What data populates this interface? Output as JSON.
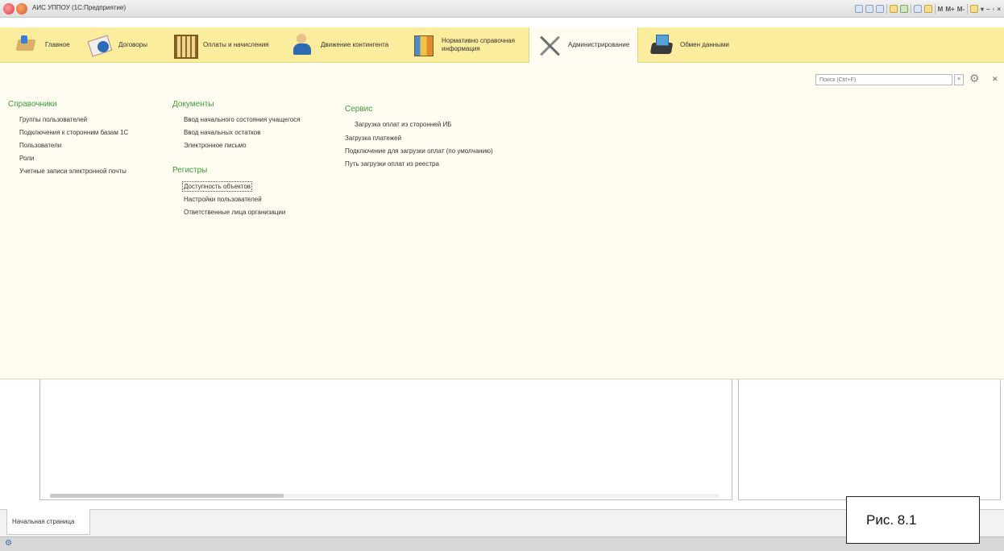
{
  "window": {
    "title": "АИС УППОУ  (1С:Предприятие)"
  },
  "toolbar": {
    "m_labels": [
      "M",
      "M+",
      "M-"
    ]
  },
  "sections": [
    {
      "label": "Главное",
      "icon": "home-icon"
    },
    {
      "label": "Договоры",
      "icon": "contract-icon"
    },
    {
      "label": "Оплаты и начисления",
      "icon": "payments-icon"
    },
    {
      "label": "Движение контингента",
      "icon": "contingent-icon"
    },
    {
      "label": "Нормативно справочная\nинформация",
      "icon": "reference-info-icon"
    },
    {
      "label": "Администрирование",
      "icon": "tools-icon",
      "active": true
    },
    {
      "label": "Обмен данными",
      "icon": "data-exchange-icon"
    }
  ],
  "search": {
    "placeholder": "Поиск (Ctrl+F)"
  },
  "groups": {
    "directories": {
      "title": "Справочники",
      "items": [
        "Группы пользователей",
        "Подключения к сторонним базам 1С",
        "Пользователи",
        "Роли",
        "Учетные записи электронной почты"
      ]
    },
    "documents": {
      "title": "Документы",
      "items": [
        "Ввод начального состояния учащегося",
        "Ввод начальных остатков",
        "Электронное письмо"
      ]
    },
    "registers": {
      "title": "Регистры",
      "items": [
        "Доступность объектов",
        "Настройки пользователей",
        "Ответственные лица организации"
      ]
    },
    "service": {
      "title": "Сервис",
      "items": [
        "Загрузка оплат из сторонней ИБ",
        "Загрузка платежей",
        "Подключение для загрузки оплат (по умолчанию)",
        "Путь загрузки оплат из реестра"
      ]
    }
  },
  "bottom_tab": {
    "label": "Начальная страница"
  },
  "caption": "Рис. 8.1"
}
